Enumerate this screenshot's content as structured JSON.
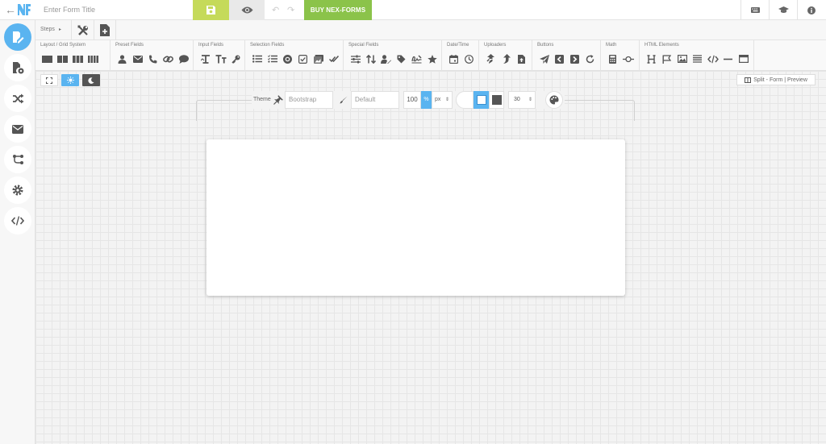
{
  "header": {
    "logo_text": "NF",
    "form_title_placeholder": "Enter Form Title",
    "buy_label": "BUY NEX-FORMS",
    "colors": {
      "save": "#c5da5a",
      "buy": "#8bc34a",
      "accent": "#5ab4f0"
    }
  },
  "sidebar": {
    "items": [
      {
        "icon": "form-edit-icon",
        "active": true
      },
      {
        "icon": "file-settings-icon"
      },
      {
        "icon": "shuffle-icon"
      },
      {
        "icon": "envelope-icon"
      },
      {
        "icon": "integrations-icon"
      },
      {
        "icon": "gear-icon"
      },
      {
        "icon": "code-icon"
      }
    ]
  },
  "steps": {
    "label": "Steps",
    "caret": "▸"
  },
  "toolbar": {
    "groups": [
      {
        "label": "Layout / Grid System"
      },
      {
        "label": "Preset Fields"
      },
      {
        "label": "Input Fields"
      },
      {
        "label": "Selection Fields"
      },
      {
        "label": "Special Fields"
      },
      {
        "label": "Date/Time"
      },
      {
        "label": "Uploaders"
      },
      {
        "label": "Buttons"
      },
      {
        "label": "Math"
      },
      {
        "label": "HTML Elements"
      }
    ]
  },
  "canvas": {
    "split_label": "Split - Form | Preview",
    "theme": {
      "label": "Theme",
      "theme_value": "Bootstrap",
      "style_value": "Default",
      "width_value": "100",
      "unit_percent": "%",
      "unit_px": "px",
      "padding_value": "30"
    }
  }
}
